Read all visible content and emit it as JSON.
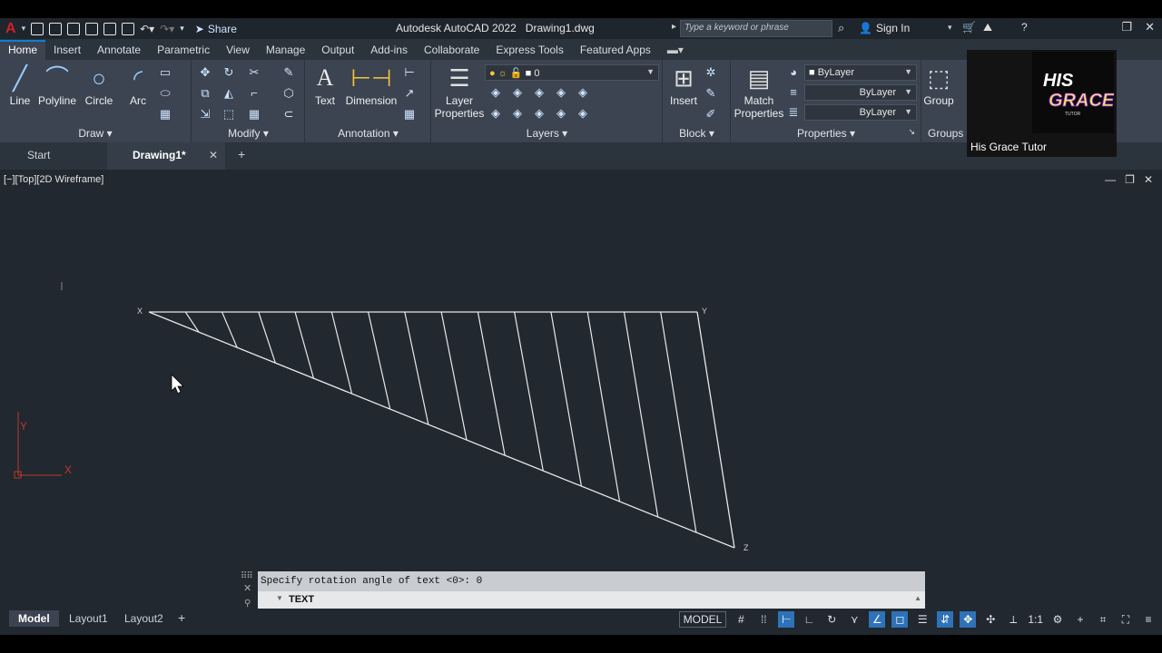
{
  "app": {
    "title": "Autodesk AutoCAD 2022",
    "document": "Drawing1.dwg",
    "share_label": "Share",
    "search_placeholder": "Type a keyword or phrase",
    "signin_label": "Sign In"
  },
  "ribbon_tabs": [
    "Home",
    "Insert",
    "Annotate",
    "Parametric",
    "View",
    "Manage",
    "Output",
    "Add-ins",
    "Collaborate",
    "Express Tools",
    "Featured Apps"
  ],
  "panels": {
    "draw": {
      "title": "Draw",
      "tools": [
        "Line",
        "Polyline",
        "Circle",
        "Arc"
      ]
    },
    "modify": {
      "title": "Modify"
    },
    "annotation": {
      "title": "Annotation",
      "tools": [
        "Text",
        "Dimension"
      ]
    },
    "layers": {
      "title": "Layers",
      "tool": "Layer Properties",
      "current_layer": "0"
    },
    "block": {
      "title": "Block",
      "tool": "Insert"
    },
    "properties": {
      "title": "Properties",
      "tool": "Match Properties",
      "color": "ByLayer",
      "linetype": "ByLayer",
      "lineweight": "ByLayer"
    },
    "groups": {
      "title": "Groups",
      "tool": "Group"
    }
  },
  "doc_tabs": {
    "start": "Start",
    "drawing": "Drawing1*"
  },
  "viewport": {
    "label": "[−][Top][2D Wireframe]"
  },
  "drawing": {
    "labels": {
      "x": "X",
      "y": "Y",
      "z": "Z"
    },
    "ucs_x": "X",
    "ucs_y": "Y"
  },
  "command": {
    "history": "Specify rotation angle of text <0>: 0",
    "input": "TEXT"
  },
  "layout_tabs": [
    "Model",
    "Layout1",
    "Layout2"
  ],
  "status": {
    "model": "MODEL",
    "scale": "1:1"
  },
  "webcam": {
    "name": "His Grace Tutor",
    "logo_line1": "HIS",
    "logo_line2": "GRACE",
    "logo_line3": "TUTOR"
  }
}
